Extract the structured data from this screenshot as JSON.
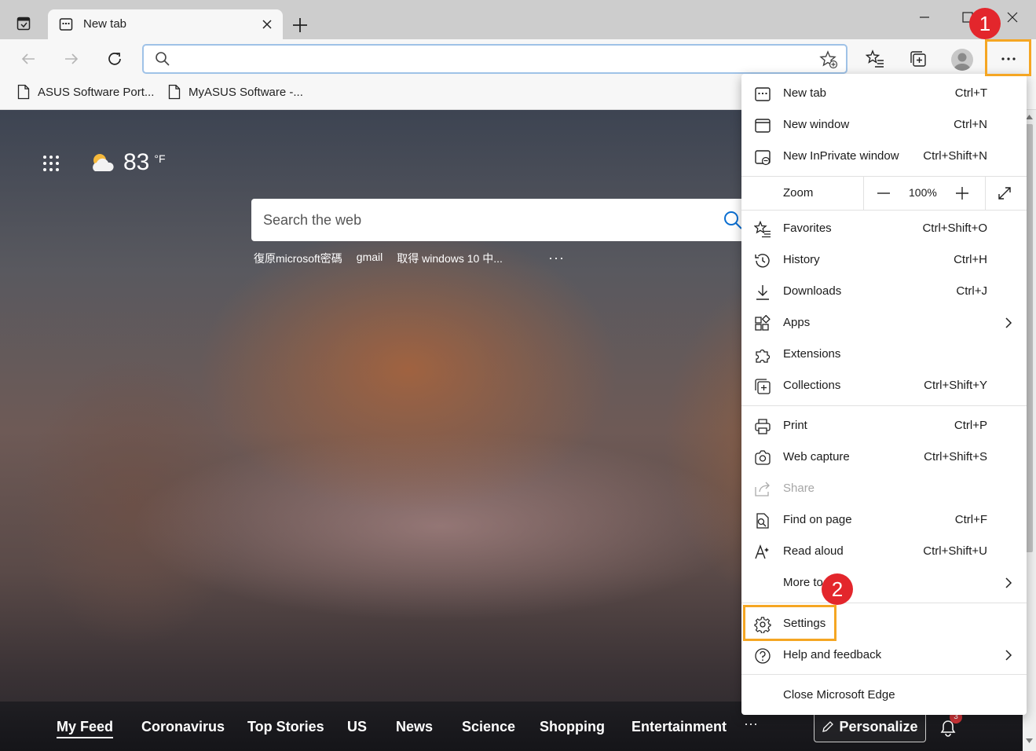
{
  "tab": {
    "title": "New tab"
  },
  "address": {
    "value": ""
  },
  "favorites_bar": [
    {
      "label": "ASUS Software Port..."
    },
    {
      "label": "MyASUS Software -..."
    }
  ],
  "weather": {
    "temp": "83",
    "unit": "°F"
  },
  "search": {
    "placeholder": "Search the web"
  },
  "quick_links": [
    "復原microsoft密碼",
    "gmail",
    "取得 windows 10 中..."
  ],
  "feed": {
    "items": [
      "My Feed",
      "Coronavirus",
      "Top Stories",
      "US",
      "News",
      "Science",
      "Shopping",
      "Entertainment"
    ],
    "more": "···",
    "personalize": "Personalize",
    "notifications_count": "3"
  },
  "menu": {
    "new_tab": {
      "label": "New tab",
      "shortcut": "Ctrl+T"
    },
    "new_window": {
      "label": "New window",
      "shortcut": "Ctrl+N"
    },
    "new_inprivate": {
      "label": "New InPrivate window",
      "shortcut": "Ctrl+Shift+N"
    },
    "zoom": {
      "label": "Zoom",
      "value": "100%"
    },
    "favorites": {
      "label": "Favorites",
      "shortcut": "Ctrl+Shift+O"
    },
    "history": {
      "label": "History",
      "shortcut": "Ctrl+H"
    },
    "downloads": {
      "label": "Downloads",
      "shortcut": "Ctrl+J"
    },
    "apps": {
      "label": "Apps"
    },
    "extensions": {
      "label": "Extensions"
    },
    "collections": {
      "label": "Collections",
      "shortcut": "Ctrl+Shift+Y"
    },
    "print": {
      "label": "Print",
      "shortcut": "Ctrl+P"
    },
    "web_capture": {
      "label": "Web capture",
      "shortcut": "Ctrl+Shift+S"
    },
    "share": {
      "label": "Share"
    },
    "find": {
      "label": "Find on page",
      "shortcut": "Ctrl+F"
    },
    "read_aloud": {
      "label": "Read aloud",
      "shortcut": "Ctrl+Shift+U"
    },
    "more_tools": {
      "label": "More tools"
    },
    "settings": {
      "label": "Settings"
    },
    "help": {
      "label": "Help and feedback"
    },
    "close": {
      "label": "Close Microsoft Edge"
    }
  },
  "annotations": {
    "step1": "1",
    "step2": "2",
    "highlight_color": "#f5a623",
    "badge_color": "#e3262c"
  }
}
